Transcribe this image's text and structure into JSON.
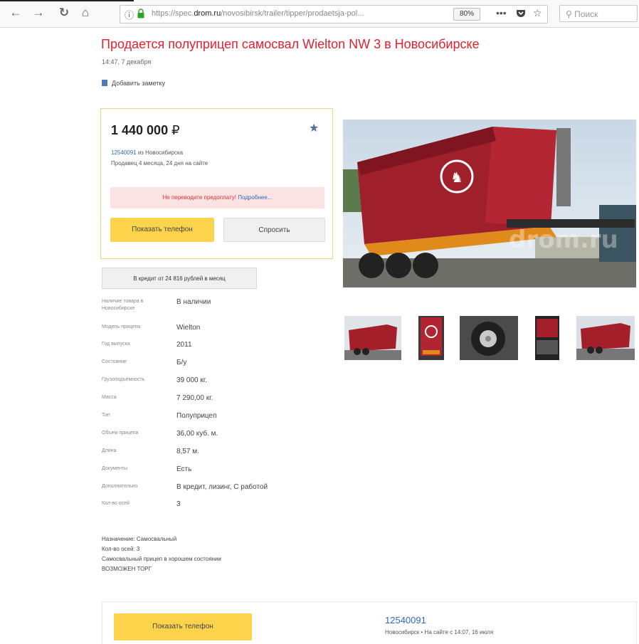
{
  "browser": {
    "url_prefix": "https://spec.",
    "url_domain": "drom.ru",
    "url_path": "/novosibirsk/trailer/tipper/prodaetsja-pol...",
    "zoom": "80%",
    "search_placeholder": "Поиск"
  },
  "listing": {
    "title": "Продается полуприцеп самосвал Wielton NW 3 в Новосибирске",
    "date": "14:47, 7 декабря",
    "add_note": "Добавить заметку",
    "price": "1 440 000",
    "currency": "₽",
    "seller_id": "12540091",
    "seller_city": " из Новосибирска",
    "on_sale": "Продавец 4 месяца, 24 дня на сайте",
    "warning_text": "Не переводите предоплату!",
    "warning_link": "Подробнее...",
    "show_phone": "Показать телефон",
    "ask": "Спросить",
    "credit": "В кредит от 24 816 рублей в месяц"
  },
  "specs": [
    {
      "key": "Наличие товара в Новосибирске",
      "value": "В наличии"
    },
    {
      "key": "Модель прицепа",
      "value": "Wielton"
    },
    {
      "key": "Год выпуска",
      "value": "2011"
    },
    {
      "key": "Состояние",
      "value": "Б/у"
    },
    {
      "key": "Грузоподъемность",
      "value": "39 000 кг."
    },
    {
      "key": "Масса",
      "value": "7 290,00 кг."
    },
    {
      "key": "Тип",
      "value": "Полуприцеп"
    },
    {
      "key": "Объем прицепа",
      "value": "36,00 куб. м."
    },
    {
      "key": "Длина",
      "value": "8,57 м."
    },
    {
      "key": "Документы",
      "value": "Есть"
    },
    {
      "key": "Дополнительно",
      "value": "В кредит, лизинг, С работой"
    },
    {
      "key": "Кол-во осей",
      "value": "3"
    }
  ],
  "description": [
    "Назначение: Самосвальный",
    "Кол-во осей: 3",
    "Самосвальный прицеп в хорошем состоянии",
    "ВОЗМОЖЕН ТОРГ"
  ],
  "bottom": {
    "show_phone": "Показать телефон",
    "seller_id": "12540091",
    "seller_meta": "Новосибирск  •  На сайте с 14:07, 16 июля"
  },
  "colors": {
    "title_red": "#e0222f",
    "button_yellow": "#fdd34b",
    "link_blue": "#2a6bbf"
  }
}
